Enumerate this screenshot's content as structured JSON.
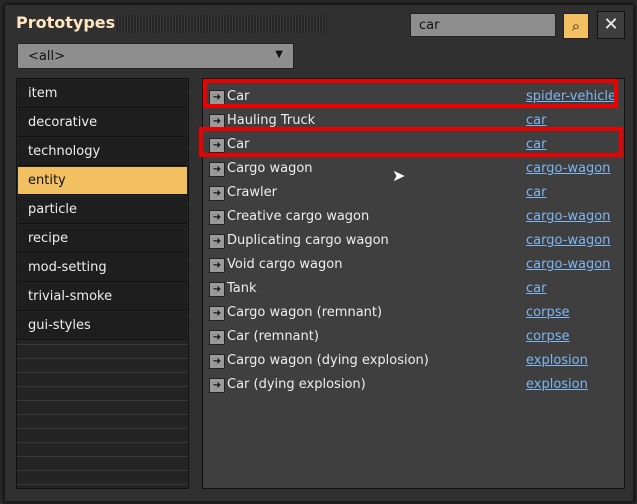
{
  "window": {
    "title": "Prototypes"
  },
  "search": {
    "value": "car",
    "search_icon": "magnifier-icon",
    "close_icon": "close-icon"
  },
  "filter": {
    "selected": "<all>"
  },
  "categories": [
    {
      "label": "item"
    },
    {
      "label": "decorative"
    },
    {
      "label": "technology"
    },
    {
      "label": "entity",
      "selected": true
    },
    {
      "label": "particle"
    },
    {
      "label": "recipe"
    },
    {
      "label": "mod-setting"
    },
    {
      "label": "trivial-smoke"
    },
    {
      "label": "gui-styles"
    }
  ],
  "results": [
    {
      "name": "Car",
      "type": "spider-vehicle",
      "highlighted": true
    },
    {
      "name": "Hauling Truck",
      "type": "car"
    },
    {
      "name": "Car",
      "type": "car",
      "highlighted": true
    },
    {
      "name": "Cargo wagon",
      "type": "cargo-wagon"
    },
    {
      "name": "Crawler",
      "type": "car"
    },
    {
      "name": "Creative cargo wagon",
      "type": "cargo-wagon"
    },
    {
      "name": "Duplicating cargo wagon",
      "type": "cargo-wagon"
    },
    {
      "name": "Void cargo wagon",
      "type": "cargo-wagon"
    },
    {
      "name": "Tank",
      "type": "car"
    },
    {
      "name": "Cargo wagon (remnant)",
      "type": "corpse"
    },
    {
      "name": "Car (remnant)",
      "type": "corpse"
    },
    {
      "name": "Cargo wagon (dying explosion)",
      "type": "explosion"
    },
    {
      "name": "Car (dying explosion)",
      "type": "explosion"
    }
  ],
  "colors": {
    "accent": "#f2c060",
    "link": "#7fb6f0",
    "highlight": "#ee0000"
  }
}
